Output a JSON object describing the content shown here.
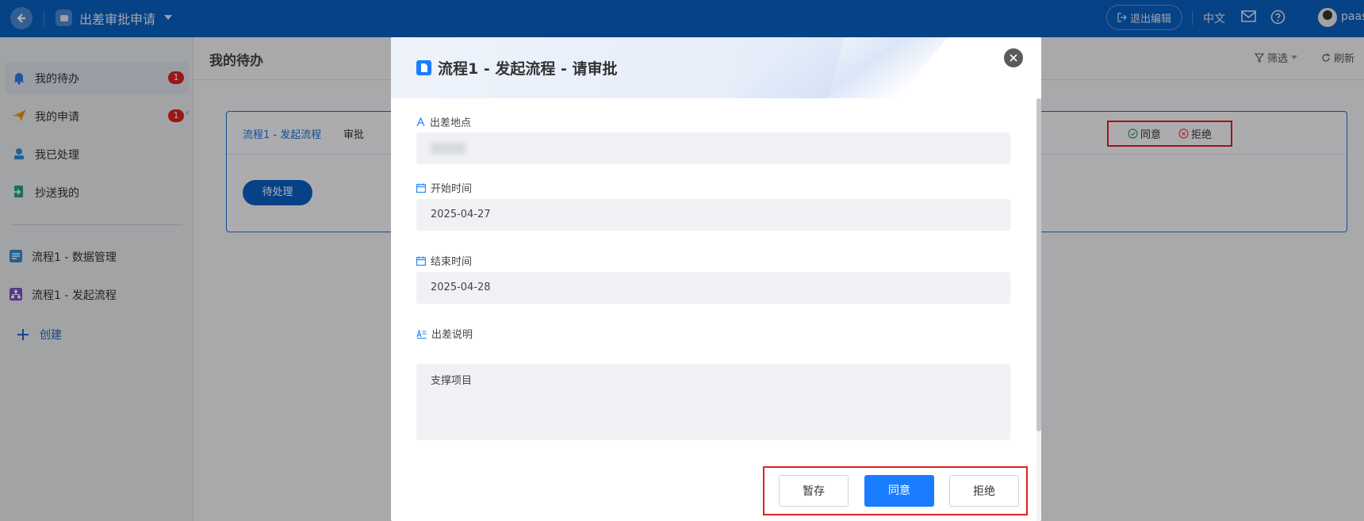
{
  "header": {
    "app_title": "出差审批申请",
    "exit_edit_label": "退出编辑",
    "language": "中文",
    "user_name": "paas"
  },
  "sidebar": {
    "items": [
      {
        "label": "我的待办",
        "badge": "1",
        "icon": "bell-icon"
      },
      {
        "label": "我的申请",
        "badge": "1",
        "icon": "paper-plane-icon"
      },
      {
        "label": "我已处理",
        "icon": "user-stamp-icon"
      },
      {
        "label": "抄送我的",
        "icon": "copy-send-icon"
      },
      {
        "label": "流程1 - 数据管理",
        "icon": "data-form-icon"
      },
      {
        "label": "流程1 - 发起流程",
        "icon": "flow-icon"
      }
    ],
    "create_label": "创建"
  },
  "main": {
    "title": "我的待办",
    "filter_label": "筛选",
    "refresh_label": "刷新",
    "card": {
      "flow_name": "流程1 - 发起流程",
      "tag": "审批",
      "status": "待处理",
      "agree_label": "同意",
      "reject_label": "拒绝"
    }
  },
  "modal": {
    "title": "流程1 - 发起流程 - 请审批",
    "fields": {
      "location_label": "出差地点",
      "start_label": "开始时间",
      "start_value": "2025-04-27",
      "end_label": "结束时间",
      "end_value": "2025-04-28",
      "desc_label": "出差说明",
      "desc_value": "支撑项目"
    },
    "buttons": {
      "save": "暂存",
      "agree": "同意",
      "reject": "拒绝"
    }
  },
  "colors": {
    "header_bg": "#0a5fc0",
    "accent": "#1a7dff",
    "highlight_border": "#e02020"
  }
}
